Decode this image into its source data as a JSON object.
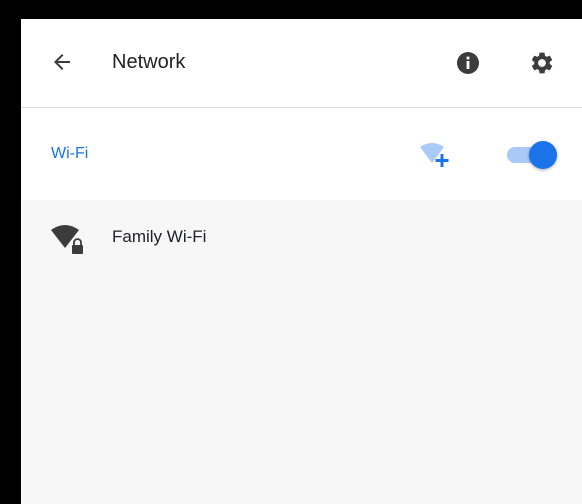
{
  "header": {
    "title": "Network",
    "back_icon": "arrow-left-icon",
    "info_icon": "info-icon",
    "settings_icon": "gear-icon"
  },
  "wifi": {
    "label": "Wi-Fi",
    "add_network_icon": "wifi-add-icon",
    "toggle_on": true
  },
  "networks": [
    {
      "name": "Family Wi-Fi",
      "icon": "wifi-locked-icon",
      "secured": true
    }
  ],
  "colors": {
    "accent": "#1a73e8",
    "accent_light": "#a9c9f7",
    "text": "#202124",
    "icon": "#3c3c3c",
    "background": "#f7f7f7",
    "frame": "#000000"
  }
}
